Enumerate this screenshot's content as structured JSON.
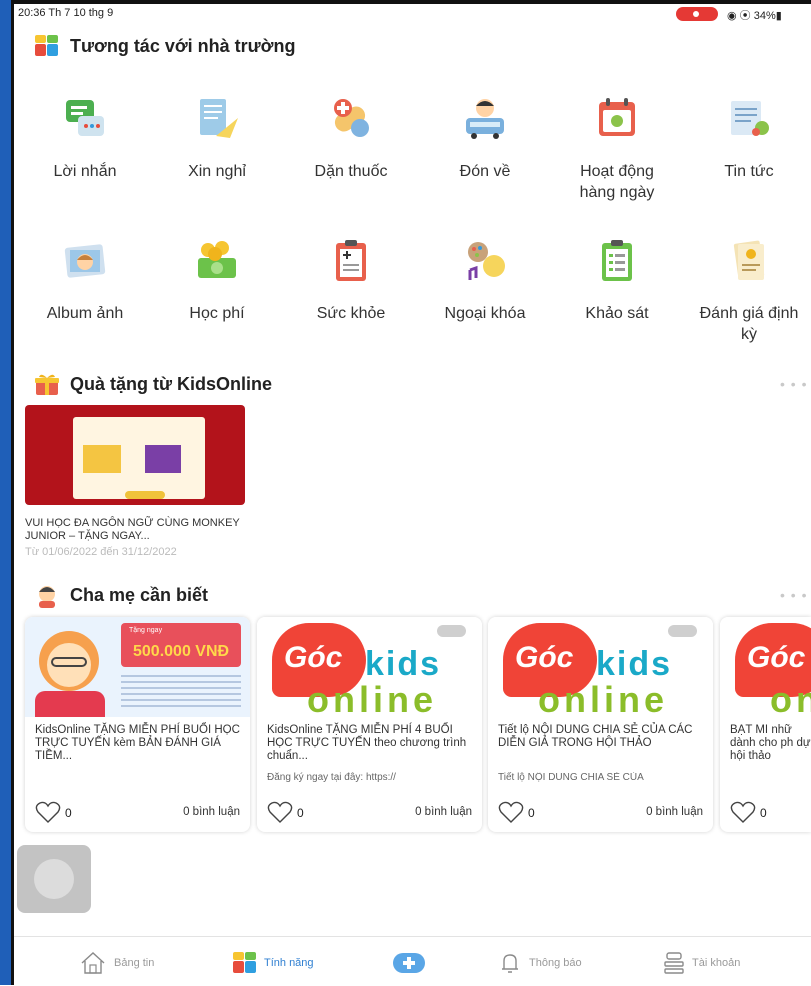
{
  "status_bar": {
    "time": "20:36  Th 7 10 thg 9",
    "right_info": "◉ ⦿ 34%▮"
  },
  "sections": {
    "interact": {
      "title": "Tương tác với nhà trường"
    },
    "gift": {
      "title": "Quà tặng từ KidsOnline",
      "more": "• • •"
    },
    "parents": {
      "title": "Cha mẹ cần biết",
      "more": "• • •"
    }
  },
  "features": [
    {
      "label": "Lời nhắn",
      "icon": "message-icon"
    },
    {
      "label": "Xin nghỉ",
      "icon": "leave-request-icon"
    },
    {
      "label": "Dặn thuốc",
      "icon": "medicine-icon"
    },
    {
      "label": "Đón về",
      "icon": "pickup-bus-icon"
    },
    {
      "label": "Hoạt động hàng ngày",
      "icon": "calendar-icon"
    },
    {
      "label": "Tin tức",
      "icon": "news-icon"
    },
    {
      "label": "Album ảnh",
      "icon": "photo-album-icon"
    },
    {
      "label": "Học phí",
      "icon": "tuition-money-icon"
    },
    {
      "label": "Sức khỏe",
      "icon": "health-clipboard-icon"
    },
    {
      "label": "Ngoại khóa",
      "icon": "extracurricular-icon"
    },
    {
      "label": "Khảo sát",
      "icon": "survey-icon"
    },
    {
      "label": "Đánh giá định kỳ",
      "icon": "evaluation-icon"
    }
  ],
  "gift_card": {
    "title": "VUI HỌC ĐA NGÔN NGỮ CÙNG MONKEY JUNIOR – TẶNG NGAY...",
    "date": "Từ 01/06/2022 đến 31/12/2022"
  },
  "news": [
    {
      "title": "KidsOnline TẶNG MIỄN PHÍ BUỔI HỌC TRỰC TUYẾN kèm BẢN ĐÁNH GIÁ TIỀM...",
      "subtitle": "",
      "likes": "0",
      "comments": "0 bình luận",
      "image": {
        "amount": "500.000 VNĐ",
        "banner_text": "Tặng ngay"
      }
    },
    {
      "title": "KidsOnline TẶNG MIỄN PHÍ 4 BUỔI HỌC TRỰC TUYẾN theo chương trình chuẩn...",
      "subtitle": "Đăng ký ngay tại đây: https://",
      "likes": "0",
      "comments": "0 bình luận",
      "image": {
        "goc": "Góc",
        "kids": "kids",
        "online": "online"
      }
    },
    {
      "title": "Tiết lộ NỘI DUNG CHIA SẺ CỦA CÁC DIỄN GIẢ TRONG HỘI THẢO",
      "subtitle": "Tiết lộ NỘI DUNG CHIA SẺ CỦA",
      "likes": "0",
      "comments": "0 bình luận",
      "image": {
        "goc": "Góc",
        "kids": "kids",
        "online": "online"
      }
    },
    {
      "title": "BẬT MÍ nhữ dành cho ph dự hội thảo",
      "subtitle": "",
      "likes": "0",
      "comments": "",
      "image": {
        "goc": "Góc",
        "kids": "",
        "online": "onl"
      }
    }
  ],
  "bottom_nav": [
    {
      "label": "Bảng tin",
      "icon": "home-icon"
    },
    {
      "label": "Tính năng",
      "icon": "features-icon",
      "active": true
    },
    {
      "label": "",
      "icon": "add-icon"
    },
    {
      "label": "Thông báo",
      "icon": "bell-icon"
    },
    {
      "label": "Tài khoản",
      "icon": "account-icon"
    }
  ],
  "colors": {
    "accent": "#2f7fd1",
    "brand_red": "#f04437",
    "brand_blue": "#1aa9c8",
    "brand_green": "#8bbd2a"
  }
}
